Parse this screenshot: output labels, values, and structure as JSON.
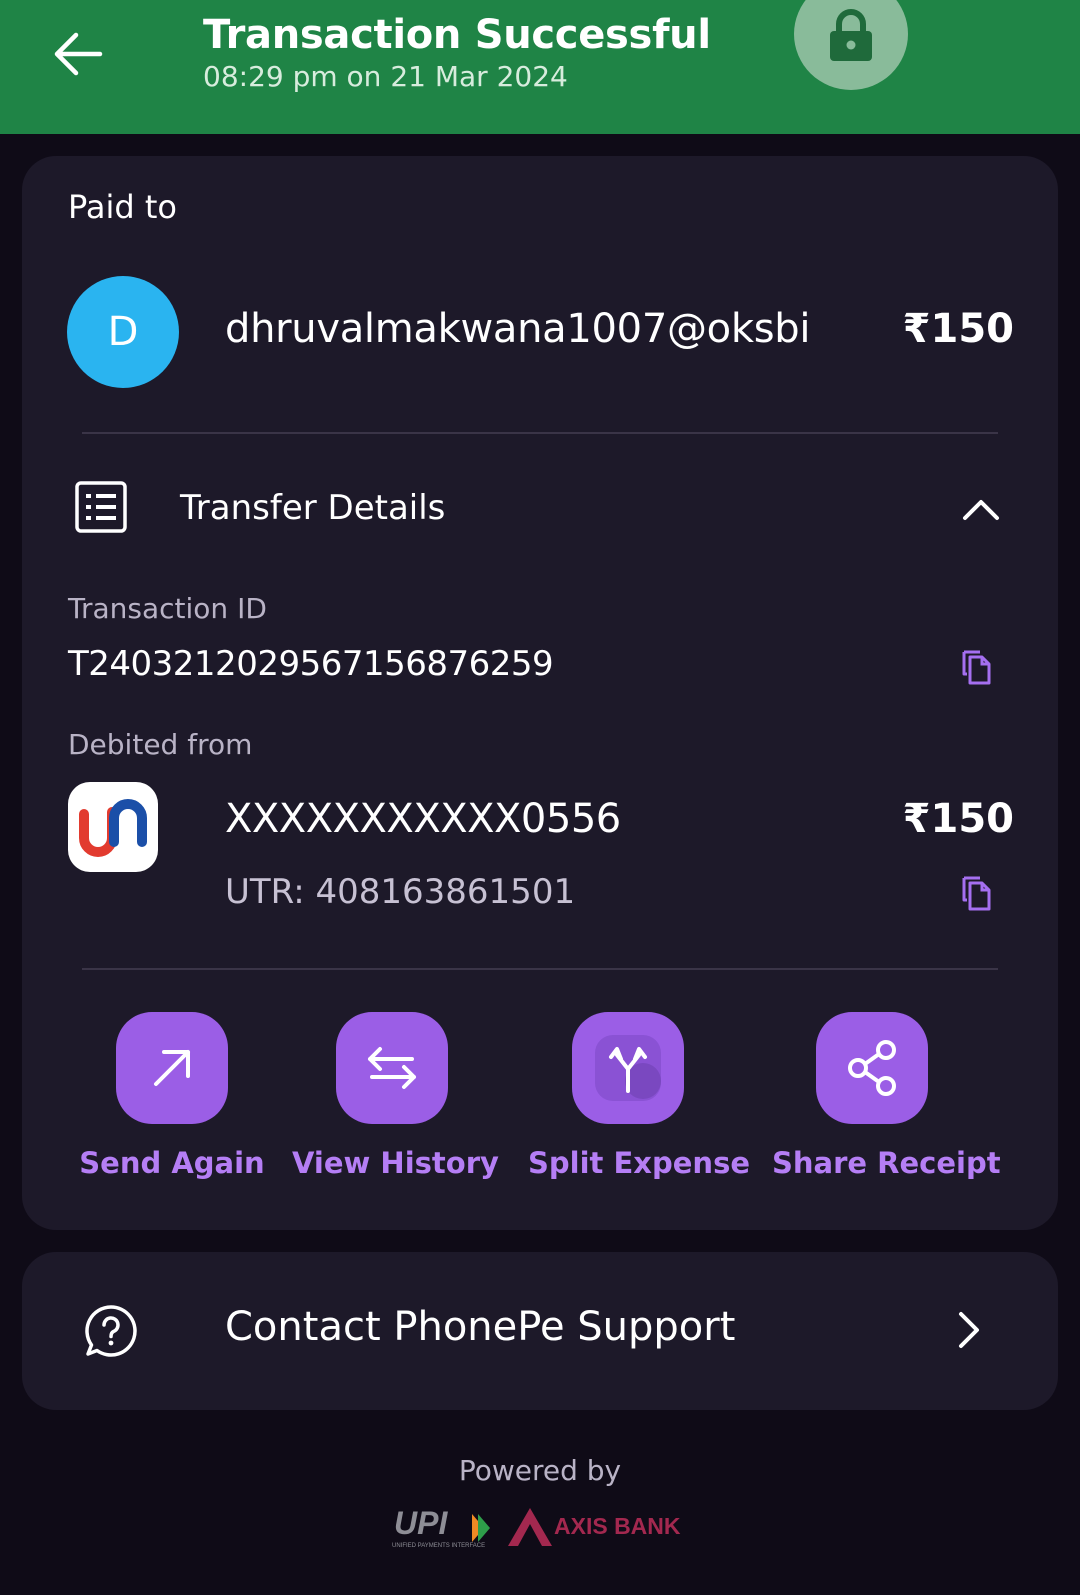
{
  "header": {
    "title": "Transaction Successful",
    "subtitle": "08:29 pm on 21 Mar 2024",
    "back_icon": "arrow-left-icon",
    "lock_icon": "lock-icon",
    "color": "#1f8446"
  },
  "payee": {
    "section_label": "Paid to",
    "avatar_letter": "D",
    "avatar_color": "#2ab4f0",
    "upi_id": "dhruvalmakwana1007@oksbi",
    "amount": "₹150"
  },
  "transfer_details": {
    "label": "Transfer Details",
    "transaction_id_label": "Transaction ID",
    "transaction_id": "T2403212029567156876259",
    "debited_from_label": "Debited from",
    "account": "XXXXXXXXXXX0556",
    "amount": "₹150",
    "utr": "UTR: 408163861501"
  },
  "actions": [
    {
      "label": "Send Again",
      "icon": "arrow-up-right-icon"
    },
    {
      "label": "View History",
      "icon": "swap-arrows-icon"
    },
    {
      "label": "Split Expense",
      "icon": "split-icon"
    },
    {
      "label": "Share Receipt",
      "icon": "share-icon"
    }
  ],
  "support": {
    "label": "Contact PhonePe Support",
    "icon": "help-chat-icon"
  },
  "footer": {
    "powered_by": "Powered by",
    "upi_logo_text": "UPI",
    "upi_logo_subtext": "UNIFIED PAYMENTS INTERFACE",
    "bank_logo_text": "AXIS BANK"
  },
  "colors": {
    "accent": "#9b5ee6",
    "accent_text": "#b57ef5",
    "card_bg": "#1d1929",
    "page_bg": "#0f0b17",
    "success_green": "#1f8446"
  }
}
